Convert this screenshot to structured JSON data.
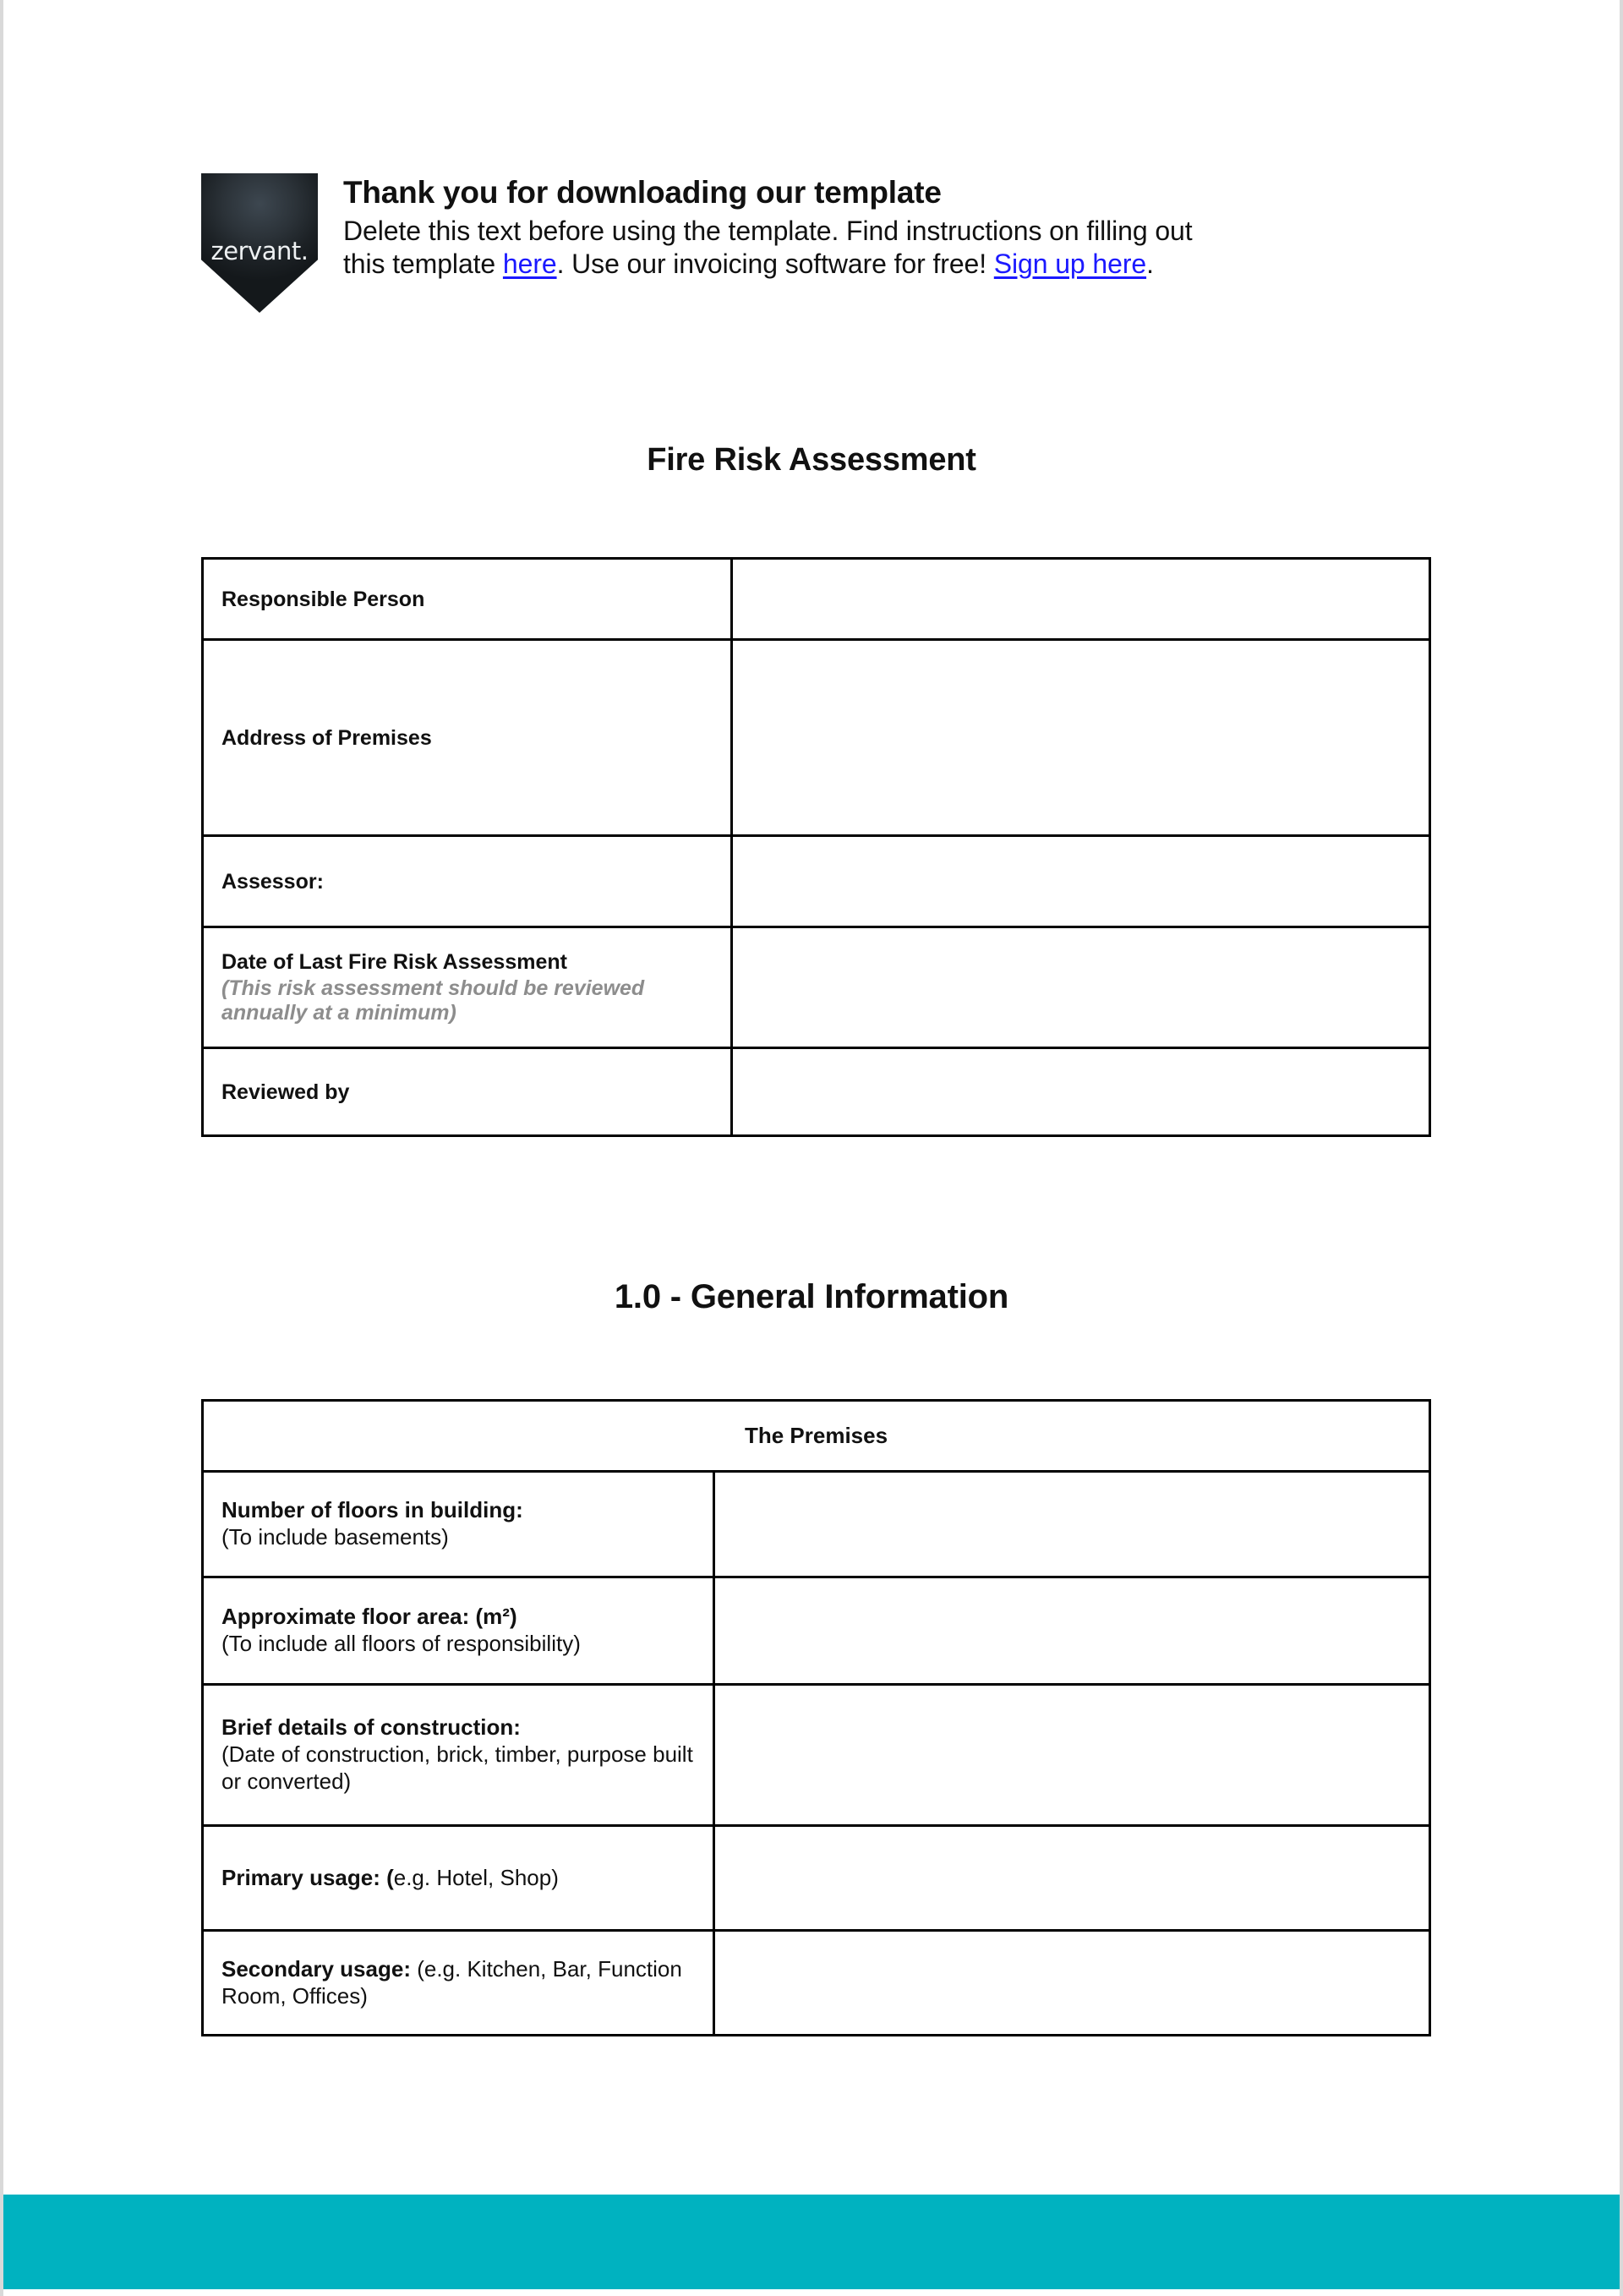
{
  "promo": {
    "logo_text": "zervant",
    "title": "Thank you for downloading our template",
    "line1_before": "Delete this text before using the template. Find instructions on filling out",
    "line2_before": "this template ",
    "link1": "here",
    "line2_middle": ". Use our invoicing software for free! ",
    "link2": "Sign up here",
    "line2_after": "."
  },
  "headings": {
    "document_title": "Fire Risk Assessment",
    "section_1": "1.0 - General Information"
  },
  "details_table": {
    "rows": [
      {
        "label": "Responsible Person",
        "note": "",
        "value": ""
      },
      {
        "label": "Address of Premises",
        "note": "",
        "value": ""
      },
      {
        "label": "Assessor:",
        "note": "",
        "value": ""
      },
      {
        "label": "Date of Last Fire Risk Assessment",
        "note": "(This risk assessment should be reviewed annually at a minimum)",
        "value": ""
      },
      {
        "label": "Reviewed by",
        "note": "",
        "value": ""
      }
    ]
  },
  "premises_table": {
    "header": "The Premises",
    "rows": [
      {
        "label_bold": "Number of floors in building:",
        "label_rest": "(To include basements)",
        "value": ""
      },
      {
        "label_bold": "Approximate floor area: (m²)",
        "label_rest": "(To include all floors of responsibility)",
        "value": ""
      },
      {
        "label_bold": "Brief details of construction:",
        "label_rest": "(Date of construction, brick, timber, purpose built or converted)",
        "value": ""
      },
      {
        "label_bold": "Primary usage: (",
        "label_rest": "e.g. Hotel, Shop)",
        "value": ""
      },
      {
        "label_bold": "Secondary usage:",
        "label_rest": " (e.g. Kitchen, Bar, Function Room, Offices)",
        "value": ""
      }
    ]
  },
  "colors": {
    "footer_bar": "#00b2c0",
    "link": "#1b19ff",
    "note_text": "#8d8d8d",
    "page_background": "#d9d9d9"
  }
}
